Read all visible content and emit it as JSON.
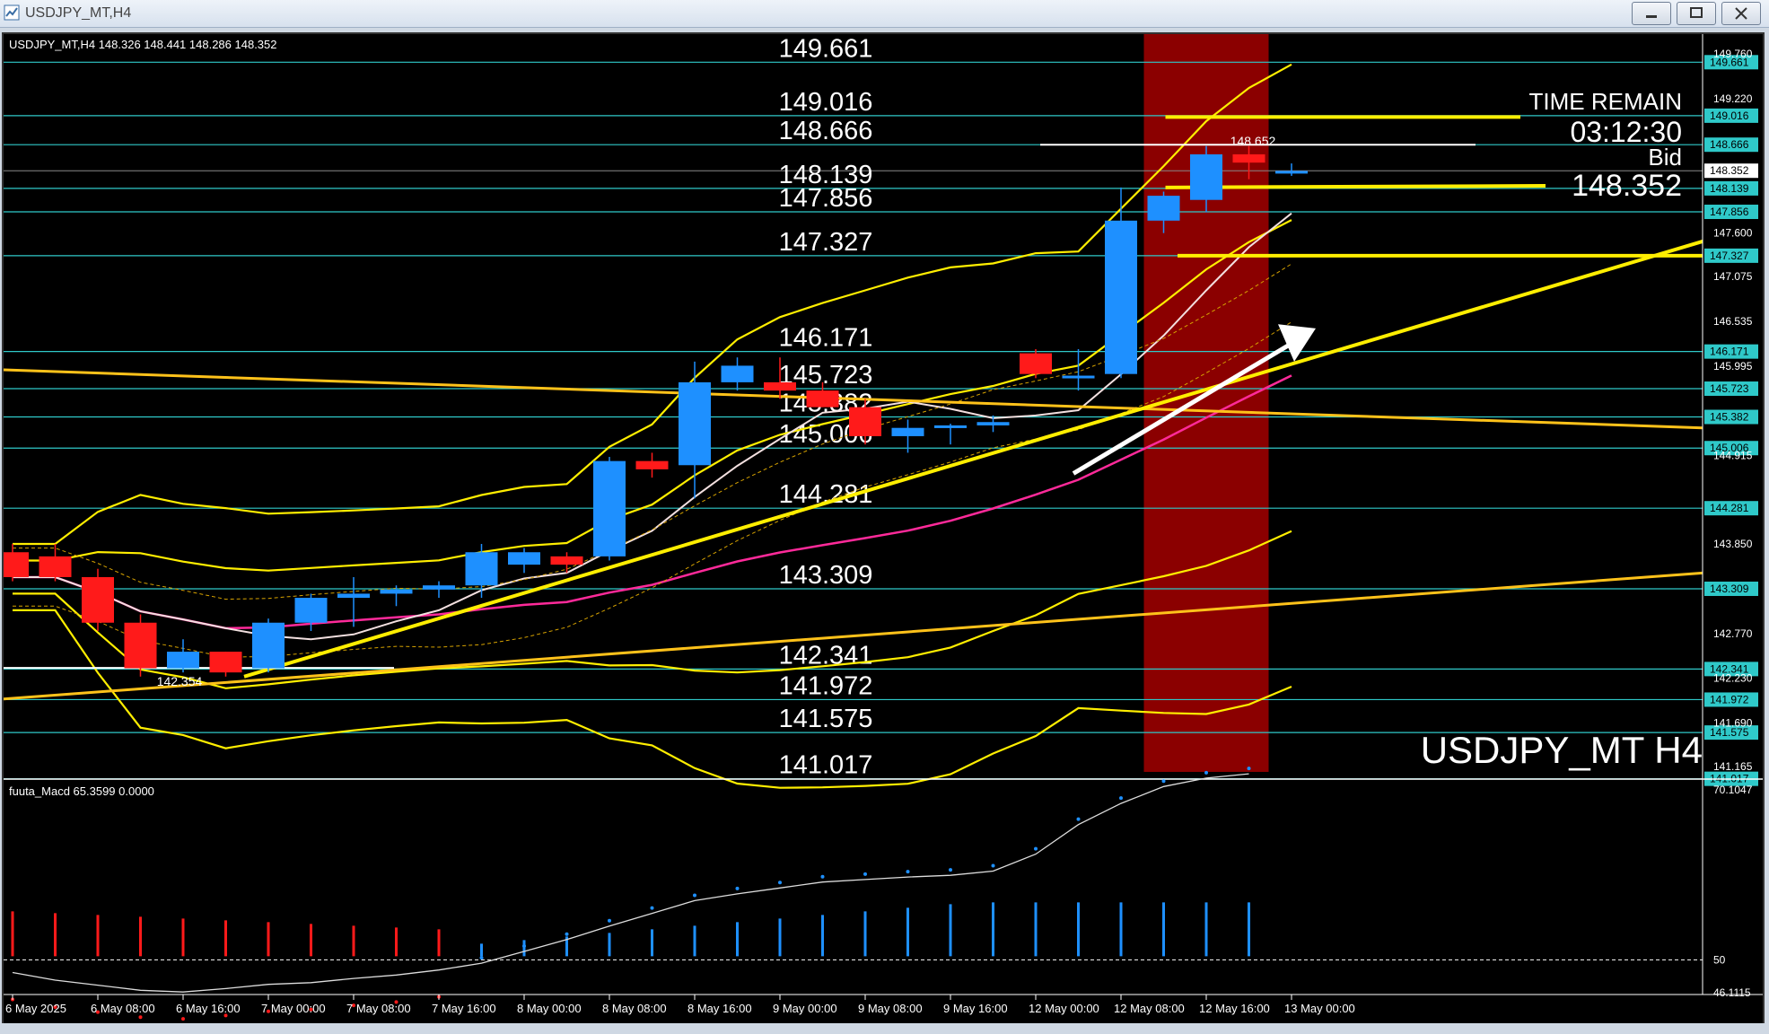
{
  "window": {
    "title": "USDJPY_MT,H4"
  },
  "header_info": "USDJPY_MT,H4  148.326 148.441 148.286 148.352",
  "symbol_watermark": "USDJPY_MT H4",
  "time_remain": {
    "label": "TIME REMAIN",
    "value": "03:12:30",
    "bid_label": "Bid",
    "bid_value": "148.352"
  },
  "high_marker": "148.652",
  "low_marker": "142.354",
  "indicator_label": "fuuta_Macd 65.3599   0.0000",
  "colors": {
    "bull": "#1e90ff",
    "bear": "#ff1a1a",
    "level": "#2fc9c9",
    "trend": "#ffee00",
    "session": "#8b0000"
  },
  "chart_data": {
    "type": "candlestick",
    "title": "USDJPY_MT,H4",
    "ylim": [
      141.1,
      150.0
    ],
    "price_axis_ticks": [
      "149.760",
      "149.220",
      "147.600",
      "147.075",
      "146.535",
      "145.995",
      "144.915",
      "143.850",
      "142.770",
      "142.230",
      "141.690",
      "141.165"
    ],
    "levels": [
      {
        "value": 149.661,
        "label": "149.661",
        "mid": true
      },
      {
        "value": 149.016,
        "label": "149.016",
        "mid": true
      },
      {
        "value": 148.666,
        "label": "148.666",
        "mid": true
      },
      {
        "value": 148.352,
        "label": "148.352",
        "mid": false,
        "current": true
      },
      {
        "value": 148.139,
        "label": "148.139",
        "mid": true
      },
      {
        "value": 147.856,
        "label": "147.856",
        "mid": true
      },
      {
        "value": 147.327,
        "label": "147.327",
        "mid": true
      },
      {
        "value": 146.171,
        "label": "146.171",
        "mid": true
      },
      {
        "value": 145.723,
        "label": "145.723",
        "mid": true
      },
      {
        "value": 145.382,
        "label": "145.382",
        "mid": true
      },
      {
        "value": 145.006,
        "label": "145.006",
        "mid": true
      },
      {
        "value": 144.281,
        "label": "144.281",
        "mid": true
      },
      {
        "value": 143.309,
        "label": "143.309",
        "mid": true
      },
      {
        "value": 142.341,
        "label": "142.341",
        "mid": true
      },
      {
        "value": 141.972,
        "label": "141.972",
        "mid": true
      },
      {
        "value": 141.575,
        "label": "141.575",
        "mid": true
      },
      {
        "value": 141.017,
        "label": "141.017",
        "mid": true
      }
    ],
    "x_labels": [
      "6 May 2025",
      "6 May 08:00",
      "6 May 16:00",
      "7 May 00:00",
      "7 May 08:00",
      "7 May 16:00",
      "8 May 00:00",
      "8 May 08:00",
      "8 May 16:00",
      "9 May 00:00",
      "9 May 08:00",
      "9 May 16:00",
      "12 May 00:00",
      "12 May 08:00",
      "12 May 16:00",
      "13 May 00:00"
    ],
    "candles": [
      {
        "o": 143.75,
        "h": 143.85,
        "l": 143.4,
        "c": 143.45
      },
      {
        "o": 143.7,
        "h": 143.85,
        "l": 143.4,
        "c": 143.45
      },
      {
        "o": 143.45,
        "h": 143.55,
        "l": 142.8,
        "c": 142.9
      },
      {
        "o": 142.9,
        "h": 143.0,
        "l": 142.25,
        "c": 142.35
      },
      {
        "o": 142.35,
        "h": 142.7,
        "l": 142.3,
        "c": 142.55
      },
      {
        "o": 142.55,
        "h": 142.55,
        "l": 142.25,
        "c": 142.3
      },
      {
        "o": 142.35,
        "h": 142.95,
        "l": 142.3,
        "c": 142.9
      },
      {
        "o": 142.9,
        "h": 143.25,
        "l": 142.8,
        "c": 143.2
      },
      {
        "o": 143.2,
        "h": 143.45,
        "l": 142.85,
        "c": 143.25
      },
      {
        "o": 143.25,
        "h": 143.35,
        "l": 143.1,
        "c": 143.3
      },
      {
        "o": 143.3,
        "h": 143.4,
        "l": 143.2,
        "c": 143.35
      },
      {
        "o": 143.35,
        "h": 143.85,
        "l": 143.2,
        "c": 143.75
      },
      {
        "o": 143.6,
        "h": 143.8,
        "l": 143.5,
        "c": 143.75
      },
      {
        "o": 143.7,
        "h": 143.75,
        "l": 143.5,
        "c": 143.6
      },
      {
        "o": 143.7,
        "h": 144.9,
        "l": 143.65,
        "c": 144.85
      },
      {
        "o": 144.85,
        "h": 144.95,
        "l": 144.65,
        "c": 144.75
      },
      {
        "o": 144.8,
        "h": 146.05,
        "l": 144.4,
        "c": 145.8
      },
      {
        "o": 145.8,
        "h": 146.1,
        "l": 145.7,
        "c": 146.0
      },
      {
        "o": 145.8,
        "h": 146.1,
        "l": 145.6,
        "c": 145.7
      },
      {
        "o": 145.7,
        "h": 145.8,
        "l": 145.5,
        "c": 145.5
      },
      {
        "o": 145.5,
        "h": 145.6,
        "l": 145.05,
        "c": 145.15
      },
      {
        "o": 145.15,
        "h": 145.35,
        "l": 144.95,
        "c": 145.25
      },
      {
        "o": 145.25,
        "h": 145.3,
        "l": 145.05,
        "c": 145.28
      },
      {
        "o": 145.28,
        "h": 145.4,
        "l": 145.2,
        "c": 145.32
      },
      {
        "o": 146.15,
        "h": 146.2,
        "l": 145.85,
        "c": 145.9
      },
      {
        "o": 145.85,
        "h": 146.2,
        "l": 145.7,
        "c": 145.88
      },
      {
        "o": 145.9,
        "h": 148.15,
        "l": 145.85,
        "c": 147.75
      },
      {
        "o": 147.75,
        "h": 148.1,
        "l": 147.6,
        "c": 148.05
      },
      {
        "o": 148.0,
        "h": 148.65,
        "l": 147.85,
        "c": 148.55
      },
      {
        "o": 148.55,
        "h": 148.65,
        "l": 148.25,
        "c": 148.45
      },
      {
        "o": 148.33,
        "h": 148.44,
        "l": 148.29,
        "c": 148.35
      }
    ],
    "macd": {
      "ylim": [
        46.1115,
        70.1047
      ],
      "ticks": [
        "70.1047",
        "50",
        "46.1115"
      ],
      "values": [
        48.5,
        47.6,
        47.0,
        46.4,
        46.2,
        46.6,
        47.1,
        47.3,
        47.8,
        48.2,
        48.8,
        49.6,
        51.0,
        52.4,
        54.0,
        55.5,
        57.0,
        57.8,
        58.5,
        59.2,
        59.5,
        59.8,
        60.0,
        60.5,
        62.5,
        66.0,
        68.5,
        70.5,
        71.5,
        72.0
      ]
    }
  }
}
